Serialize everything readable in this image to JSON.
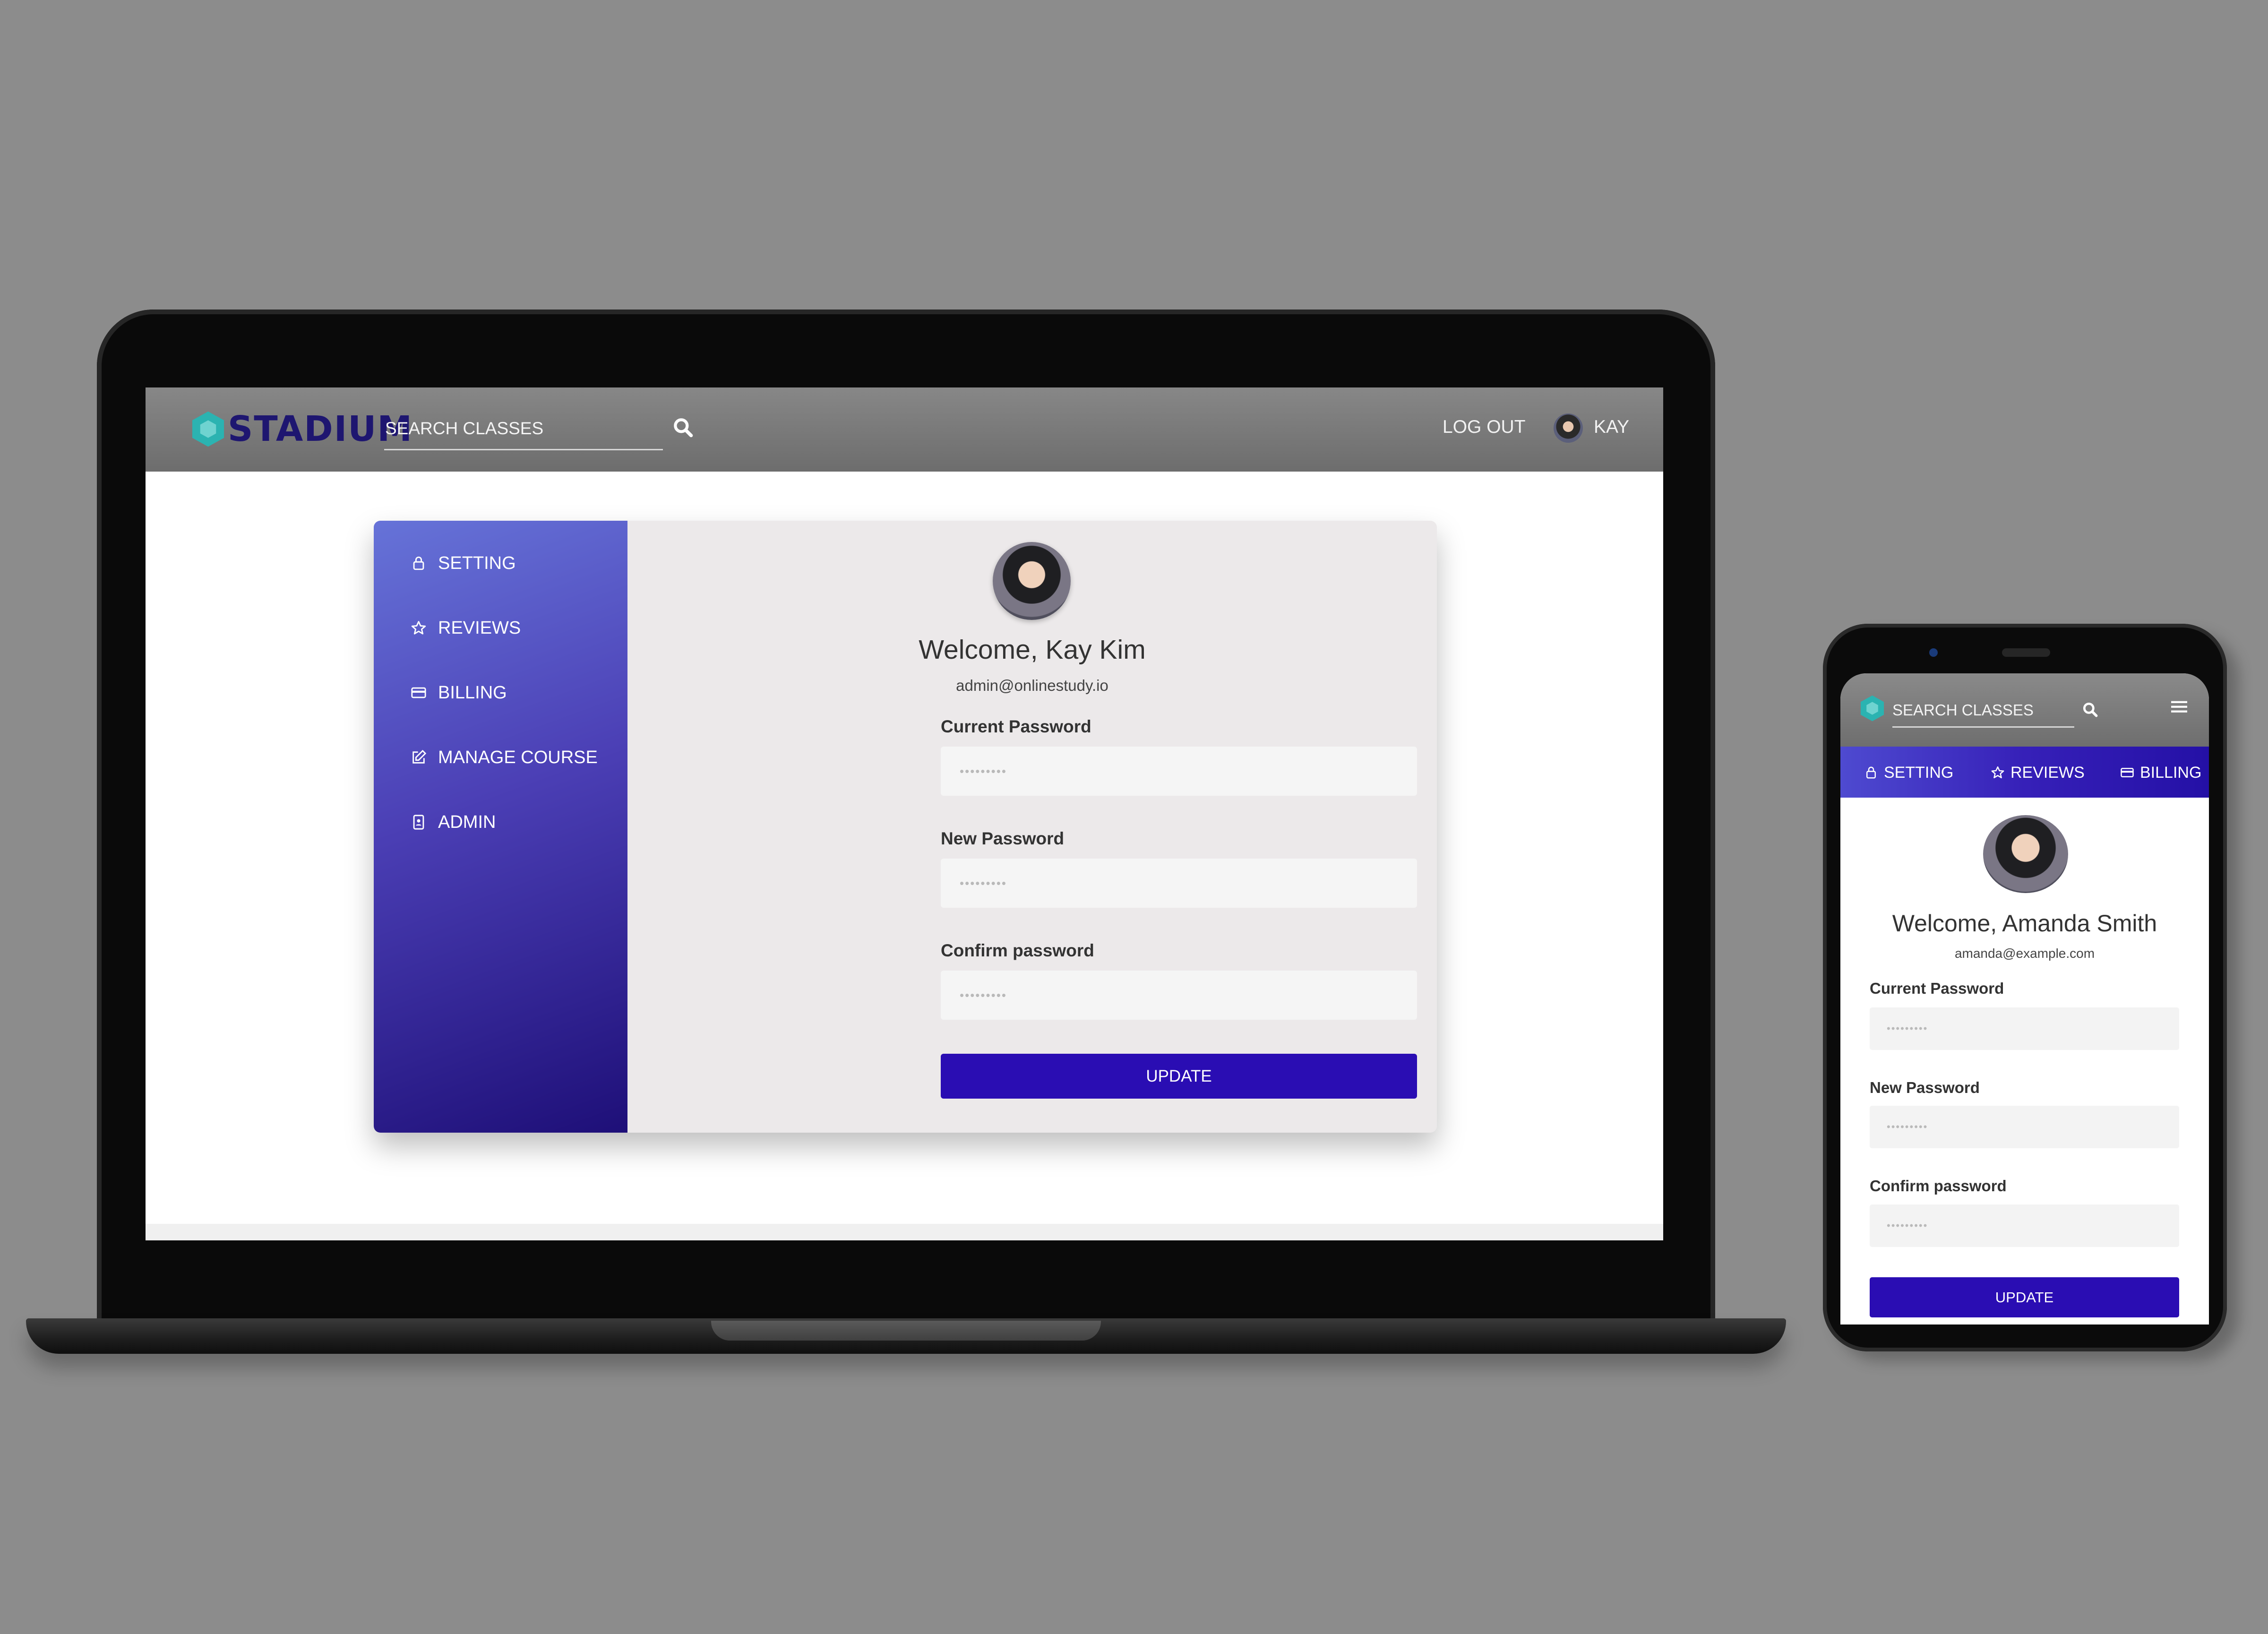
{
  "brand": {
    "name": "STADIUM"
  },
  "desktop": {
    "header": {
      "search_label": "SEARCH CLASSES",
      "logout_label": "LOG OUT",
      "user_name": "KAY"
    },
    "sidebar": {
      "items": [
        {
          "label": "SETTING",
          "icon": "lock-icon"
        },
        {
          "label": "REVIEWS",
          "icon": "star-icon"
        },
        {
          "label": "BILLING",
          "icon": "credit-card-icon"
        },
        {
          "label": "MANAGE COURSE",
          "icon": "edit-icon"
        },
        {
          "label": "ADMIN",
          "icon": "id-badge-icon"
        }
      ]
    },
    "profile": {
      "welcome": "Welcome, Kay Kim",
      "email": "admin@onlinestudy.io"
    },
    "form": {
      "current_password_label": "Current Password",
      "current_password_value": "•••••••••",
      "new_password_label": "New Password",
      "new_password_value": "•••••••••",
      "confirm_password_label": "Confirm password",
      "confirm_password_value": "•••••••••",
      "submit_label": "UPDATE"
    }
  },
  "mobile": {
    "header": {
      "search_label": "SEARCH CLASSES"
    },
    "nav": [
      {
        "label": "SETTING",
        "icon": "lock-icon"
      },
      {
        "label": "REVIEWS",
        "icon": "star-icon"
      },
      {
        "label": "BILLING",
        "icon": "credit-card-icon"
      }
    ],
    "profile": {
      "welcome": "Welcome, Amanda Smith",
      "email": "amanda@example.com"
    },
    "form": {
      "current_password_label": "Current Password",
      "current_password_value": "•••••••••",
      "new_password_label": "New Password",
      "new_password_value": "•••••••••",
      "confirm_password_label": "Confirm password",
      "confirm_password_value": "•••••••••",
      "submit_label": "UPDATE"
    }
  },
  "colors": {
    "background": "#8c8c8c",
    "accent": "#2a0db3",
    "sidebar_top": "#6673d8",
    "sidebar_bottom": "#1e0f78",
    "logo_teal": "#2bb3b1",
    "logo_text": "#1e1670"
  }
}
